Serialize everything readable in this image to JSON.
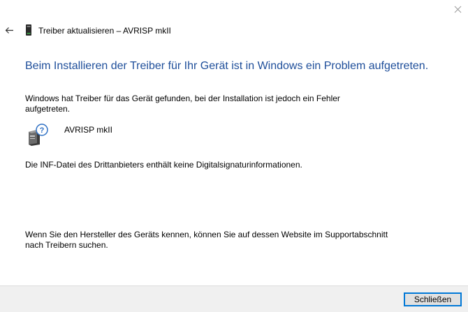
{
  "window": {
    "title": "Treiber aktualisieren – AVRISP mkII"
  },
  "main": {
    "headline": "Beim Installieren der Treiber für Ihr Gerät ist in Windows ein Problem aufgetreten.",
    "description": "Windows hat Treiber für das Gerät gefunden, bei der Installation ist jedoch ein Fehler aufgetreten.",
    "device_name": "AVRISP mkII",
    "error_text": "Die INF-Datei des Drittanbieters enthält keine Digitalsignaturinformationen.",
    "hint": "Wenn Sie den Hersteller des Geräts kennen, können Sie auf dessen Website im Supportabschnitt nach Treibern suchen."
  },
  "footer": {
    "close_label": "Schließen"
  },
  "icons": {
    "back": "arrow-left-icon",
    "close": "close-icon",
    "device_small": "usb-device-icon",
    "device_unknown": "unknown-device-icon"
  },
  "colors": {
    "headline": "#1e4e9a",
    "focus_border": "#0078d7",
    "footer_bg": "#f0f0f0"
  }
}
